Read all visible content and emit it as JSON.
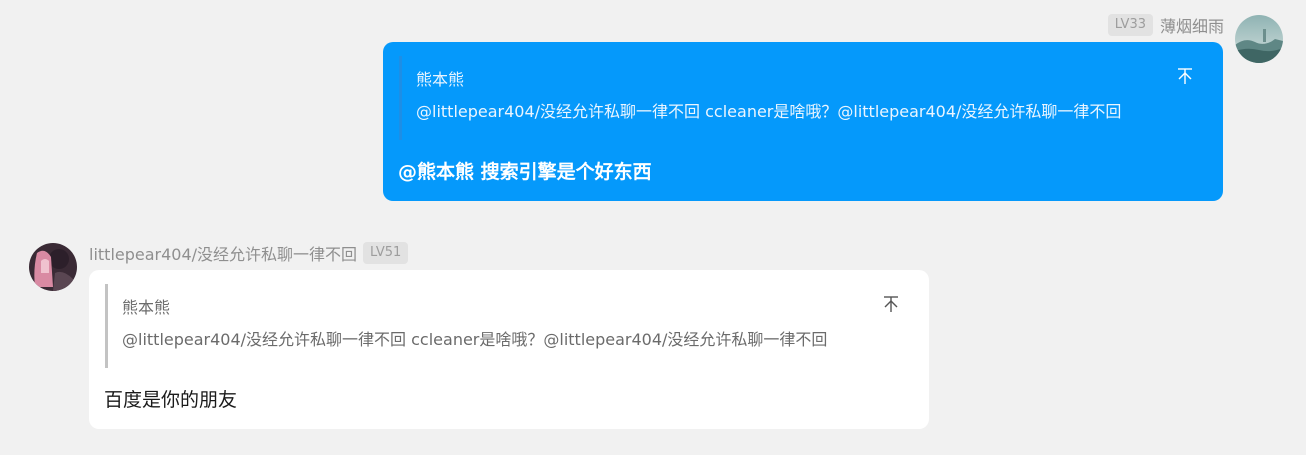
{
  "messages": [
    {
      "side": "right",
      "user": {
        "name": "薄烟细雨",
        "level": "LV33"
      },
      "quote": {
        "author": "熊本熊",
        "text": "@littlepear404/没经允许私聊一律不回 ccleaner是啥哦？@littlepear404/没经允许私聊一律不回"
      },
      "text": "@熊本熊 搜索引擎是个好东西"
    },
    {
      "side": "left",
      "user": {
        "name": "littlepear404/没经允许私聊一律不回",
        "level": "LV51"
      },
      "quote": {
        "author": "熊本熊",
        "text": "@littlepear404/没经允许私聊一律不回 ccleaner是啥哦？@littlepear404/没经允许私聊一律不回"
      },
      "text": "百度是你的朋友"
    }
  ],
  "icons": {
    "quote_pin": "pin-top-icon",
    "avatar_right": "landscape-avatar",
    "avatar_left": "anime-girl-avatar"
  },
  "colors": {
    "background": "#f1f1f1",
    "own_bubble": "#0599fb",
    "other_bubble": "#ffffff",
    "level_badge_bg": "#e2e2e2",
    "username": "#8f8f8f"
  }
}
